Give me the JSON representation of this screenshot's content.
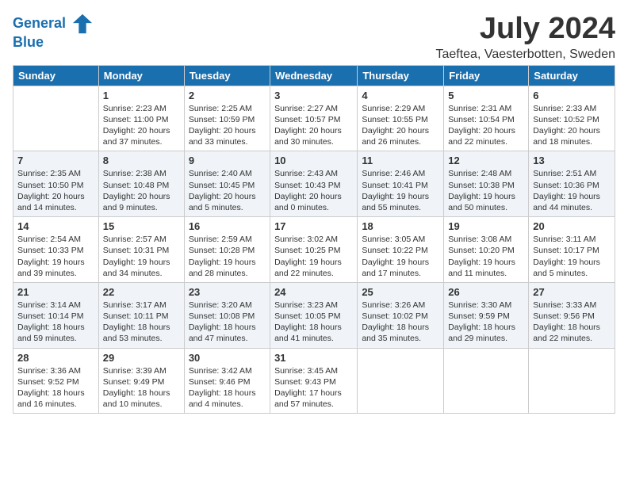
{
  "header": {
    "logo_line1": "General",
    "logo_line2": "Blue",
    "month_year": "July 2024",
    "location": "Taeftea, Vaesterbotten, Sweden"
  },
  "weekdays": [
    "Sunday",
    "Monday",
    "Tuesday",
    "Wednesday",
    "Thursday",
    "Friday",
    "Saturday"
  ],
  "weeks": [
    [
      {
        "day": "",
        "info": ""
      },
      {
        "day": "1",
        "info": "Sunrise: 2:23 AM\nSunset: 11:00 PM\nDaylight: 20 hours\nand 37 minutes."
      },
      {
        "day": "2",
        "info": "Sunrise: 2:25 AM\nSunset: 10:59 PM\nDaylight: 20 hours\nand 33 minutes."
      },
      {
        "day": "3",
        "info": "Sunrise: 2:27 AM\nSunset: 10:57 PM\nDaylight: 20 hours\nand 30 minutes."
      },
      {
        "day": "4",
        "info": "Sunrise: 2:29 AM\nSunset: 10:55 PM\nDaylight: 20 hours\nand 26 minutes."
      },
      {
        "day": "5",
        "info": "Sunrise: 2:31 AM\nSunset: 10:54 PM\nDaylight: 20 hours\nand 22 minutes."
      },
      {
        "day": "6",
        "info": "Sunrise: 2:33 AM\nSunset: 10:52 PM\nDaylight: 20 hours\nand 18 minutes."
      }
    ],
    [
      {
        "day": "7",
        "info": "Sunrise: 2:35 AM\nSunset: 10:50 PM\nDaylight: 20 hours\nand 14 minutes."
      },
      {
        "day": "8",
        "info": "Sunrise: 2:38 AM\nSunset: 10:48 PM\nDaylight: 20 hours\nand 9 minutes."
      },
      {
        "day": "9",
        "info": "Sunrise: 2:40 AM\nSunset: 10:45 PM\nDaylight: 20 hours\nand 5 minutes."
      },
      {
        "day": "10",
        "info": "Sunrise: 2:43 AM\nSunset: 10:43 PM\nDaylight: 20 hours\nand 0 minutes."
      },
      {
        "day": "11",
        "info": "Sunrise: 2:46 AM\nSunset: 10:41 PM\nDaylight: 19 hours\nand 55 minutes."
      },
      {
        "day": "12",
        "info": "Sunrise: 2:48 AM\nSunset: 10:38 PM\nDaylight: 19 hours\nand 50 minutes."
      },
      {
        "day": "13",
        "info": "Sunrise: 2:51 AM\nSunset: 10:36 PM\nDaylight: 19 hours\nand 44 minutes."
      }
    ],
    [
      {
        "day": "14",
        "info": "Sunrise: 2:54 AM\nSunset: 10:33 PM\nDaylight: 19 hours\nand 39 minutes."
      },
      {
        "day": "15",
        "info": "Sunrise: 2:57 AM\nSunset: 10:31 PM\nDaylight: 19 hours\nand 34 minutes."
      },
      {
        "day": "16",
        "info": "Sunrise: 2:59 AM\nSunset: 10:28 PM\nDaylight: 19 hours\nand 28 minutes."
      },
      {
        "day": "17",
        "info": "Sunrise: 3:02 AM\nSunset: 10:25 PM\nDaylight: 19 hours\nand 22 minutes."
      },
      {
        "day": "18",
        "info": "Sunrise: 3:05 AM\nSunset: 10:22 PM\nDaylight: 19 hours\nand 17 minutes."
      },
      {
        "day": "19",
        "info": "Sunrise: 3:08 AM\nSunset: 10:20 PM\nDaylight: 19 hours\nand 11 minutes."
      },
      {
        "day": "20",
        "info": "Sunrise: 3:11 AM\nSunset: 10:17 PM\nDaylight: 19 hours\nand 5 minutes."
      }
    ],
    [
      {
        "day": "21",
        "info": "Sunrise: 3:14 AM\nSunset: 10:14 PM\nDaylight: 18 hours\nand 59 minutes."
      },
      {
        "day": "22",
        "info": "Sunrise: 3:17 AM\nSunset: 10:11 PM\nDaylight: 18 hours\nand 53 minutes."
      },
      {
        "day": "23",
        "info": "Sunrise: 3:20 AM\nSunset: 10:08 PM\nDaylight: 18 hours\nand 47 minutes."
      },
      {
        "day": "24",
        "info": "Sunrise: 3:23 AM\nSunset: 10:05 PM\nDaylight: 18 hours\nand 41 minutes."
      },
      {
        "day": "25",
        "info": "Sunrise: 3:26 AM\nSunset: 10:02 PM\nDaylight: 18 hours\nand 35 minutes."
      },
      {
        "day": "26",
        "info": "Sunrise: 3:30 AM\nSunset: 9:59 PM\nDaylight: 18 hours\nand 29 minutes."
      },
      {
        "day": "27",
        "info": "Sunrise: 3:33 AM\nSunset: 9:56 PM\nDaylight: 18 hours\nand 22 minutes."
      }
    ],
    [
      {
        "day": "28",
        "info": "Sunrise: 3:36 AM\nSunset: 9:52 PM\nDaylight: 18 hours\nand 16 minutes."
      },
      {
        "day": "29",
        "info": "Sunrise: 3:39 AM\nSunset: 9:49 PM\nDaylight: 18 hours\nand 10 minutes."
      },
      {
        "day": "30",
        "info": "Sunrise: 3:42 AM\nSunset: 9:46 PM\nDaylight: 18 hours\nand 4 minutes."
      },
      {
        "day": "31",
        "info": "Sunrise: 3:45 AM\nSunset: 9:43 PM\nDaylight: 17 hours\nand 57 minutes."
      },
      {
        "day": "",
        "info": ""
      },
      {
        "day": "",
        "info": ""
      },
      {
        "day": "",
        "info": ""
      }
    ]
  ]
}
